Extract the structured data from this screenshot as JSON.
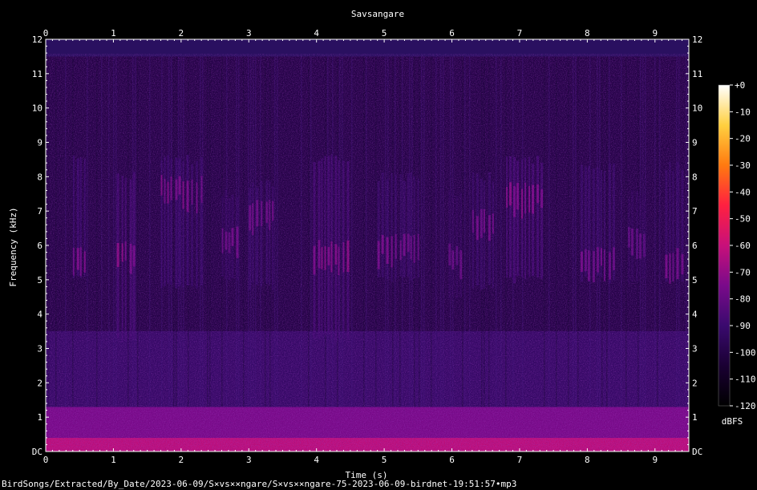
{
  "chart_data": {
    "type": "heatmap",
    "title": "Savsangare",
    "xlabel": "Time (s)",
    "ylabel": "Frequency (kHz)",
    "xlim": [
      0,
      9.5
    ],
    "ylim": [
      0,
      12
    ],
    "x_ticks": [
      "0",
      "1",
      "2",
      "3",
      "4",
      "5",
      "6",
      "7",
      "8",
      "9"
    ],
    "y_ticks": [
      "DC",
      "1",
      "2",
      "3",
      "4",
      "5",
      "6",
      "7",
      "8",
      "9",
      "10",
      "11",
      "12"
    ],
    "colorbar": {
      "label": "dBFS",
      "ticks": [
        "+0",
        "-10",
        "-20",
        "-30",
        "-40",
        "-50",
        "-60",
        "-70",
        "-80",
        "-90",
        "-100",
        "-110",
        "-120"
      ],
      "range": [
        -120,
        0
      ],
      "colors": [
        "#000000",
        "#1a0033",
        "#3a0a6e",
        "#7a0a8a",
        "#c8107a",
        "#ff2040",
        "#ff7a10",
        "#ffd040",
        "#ffffff"
      ]
    },
    "background_color": "#2a1060",
    "upper_cutoff_khz": 11.5,
    "noise_floor": [
      {
        "from_khz": 0,
        "to_khz": 0.4,
        "level_dbfs": -62
      },
      {
        "from_khz": 0.4,
        "to_khz": 1.3,
        "level_dbfs": -75
      },
      {
        "from_khz": 1.3,
        "to_khz": 3.5,
        "level_dbfs": -92
      },
      {
        "from_khz": 3.5,
        "to_khz": 11.5,
        "level_dbfs": -100
      }
    ],
    "calls": [
      {
        "start_s": 0.4,
        "end_s": 0.6,
        "low_khz": 5.0,
        "high_khz": 8.5,
        "peak_khz": 5.4,
        "peak_dbfs": -72
      },
      {
        "start_s": 1.05,
        "end_s": 1.3,
        "low_khz": 3.3,
        "high_khz": 8.0,
        "peak_khz": 5.6,
        "peak_dbfs": -70
      },
      {
        "start_s": 1.7,
        "end_s": 2.3,
        "low_khz": 4.8,
        "high_khz": 8.5,
        "peak_khz": 7.5,
        "peak_dbfs": -72
      },
      {
        "start_s": 2.6,
        "end_s": 2.85,
        "low_khz": 5.0,
        "high_khz": 7.5,
        "peak_khz": 6.0,
        "peak_dbfs": -76
      },
      {
        "start_s": 3.0,
        "end_s": 3.35,
        "low_khz": 4.8,
        "high_khz": 7.8,
        "peak_khz": 6.8,
        "peak_dbfs": -74
      },
      {
        "start_s": 3.95,
        "end_s": 4.45,
        "low_khz": 3.3,
        "high_khz": 8.5,
        "peak_khz": 5.6,
        "peak_dbfs": -70
      },
      {
        "start_s": 4.9,
        "end_s": 5.5,
        "low_khz": 5.0,
        "high_khz": 8.0,
        "peak_khz": 5.8,
        "peak_dbfs": -74
      },
      {
        "start_s": 5.95,
        "end_s": 6.15,
        "low_khz": 4.5,
        "high_khz": 7.5,
        "peak_khz": 5.5,
        "peak_dbfs": -78
      },
      {
        "start_s": 6.3,
        "end_s": 6.6,
        "low_khz": 4.8,
        "high_khz": 8.0,
        "peak_khz": 6.5,
        "peak_dbfs": -74
      },
      {
        "start_s": 6.8,
        "end_s": 7.35,
        "low_khz": 5.0,
        "high_khz": 8.5,
        "peak_khz": 7.3,
        "peak_dbfs": -70
      },
      {
        "start_s": 7.9,
        "end_s": 8.4,
        "low_khz": 5.0,
        "high_khz": 8.3,
        "peak_khz": 5.4,
        "peak_dbfs": -74
      },
      {
        "start_s": 8.6,
        "end_s": 8.85,
        "low_khz": 5.0,
        "high_khz": 7.5,
        "peak_khz": 6.0,
        "peak_dbfs": -78
      },
      {
        "start_s": 9.15,
        "end_s": 9.4,
        "low_khz": 5.0,
        "high_khz": 8.3,
        "peak_khz": 5.4,
        "peak_dbfs": -74
      }
    ]
  },
  "caption": "BirdSongs/Extracted/By_Date/2023-06-09/S×vs××ngare/S×vs××ngare-75-2023-06-09-birdnet-19:51:57•mp3"
}
